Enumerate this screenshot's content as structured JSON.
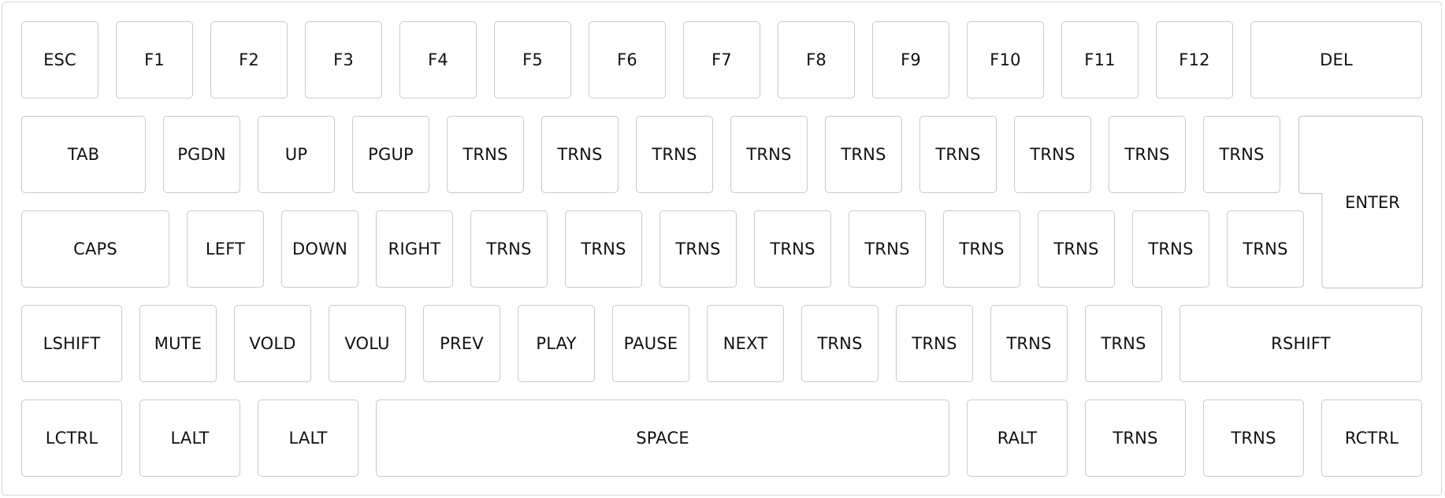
{
  "keyboard": {
    "rows": [
      [
        "ESC",
        "F1",
        "F2",
        "F3",
        "F4",
        "F5",
        "F6",
        "F7",
        "F8",
        "F9",
        "F10",
        "F11",
        "F12",
        "DEL"
      ],
      [
        "TAB",
        "PGDN",
        "UP",
        "PGUP",
        "TRNS",
        "TRNS",
        "TRNS",
        "TRNS",
        "TRNS",
        "TRNS",
        "TRNS",
        "TRNS",
        "TRNS"
      ],
      [
        "CAPS",
        "LEFT",
        "DOWN",
        "RIGHT",
        "TRNS",
        "TRNS",
        "TRNS",
        "TRNS",
        "TRNS",
        "TRNS",
        "TRNS",
        "TRNS",
        "TRNS"
      ],
      [
        "LSHIFT",
        "MUTE",
        "VOLD",
        "VOLU",
        "PREV",
        "PLAY",
        "PAUSE",
        "NEXT",
        "TRNS",
        "TRNS",
        "TRNS",
        "TRNS",
        "RSHIFT"
      ],
      [
        "LCTRL",
        "LALT",
        "LALT",
        "SPACE",
        "RALT",
        "TRNS",
        "TRNS",
        "RCTRL"
      ]
    ],
    "enter_label": "ENTER"
  }
}
